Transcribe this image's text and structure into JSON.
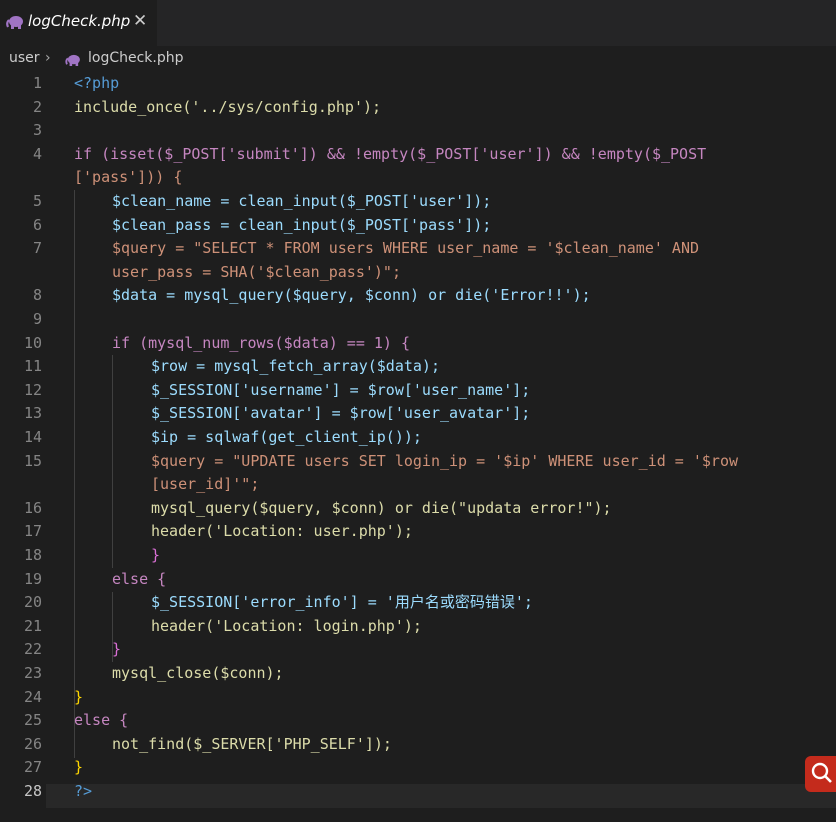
{
  "tab": {
    "title": "logCheck.php",
    "close_glyph": "✕",
    "icon": "php-elephant-icon"
  },
  "breadcrumb": {
    "folder": "user",
    "separator": "›",
    "file": "logCheck.php"
  },
  "colors": {
    "keyword": "#c586c0",
    "function": "#dcdcaa",
    "string": "#ce9178",
    "variable": "#9cdcfe",
    "number": "#b5cea8",
    "php_tag": "#569cd6"
  },
  "line_numbers": [
    "1",
    "2",
    "3",
    "4",
    "",
    "5",
    "6",
    "7",
    "",
    "8",
    "9",
    "10",
    "11",
    "12",
    "13",
    "14",
    "15",
    "",
    "16",
    "17",
    "18",
    "19",
    "20",
    "21",
    "22",
    "23",
    "24",
    "25",
    "26",
    "27",
    "28"
  ],
  "code": [
    "<?php",
    "include_once('../sys/config.php');",
    "",
    "if (isset($_POST['submit']) && !empty($_POST['user']) && !empty($_POST",
    "['pass'])) {",
    "$clean_name = clean_input($_POST['user']);",
    "$clean_pass = clean_input($_POST['pass']);",
    "$query = \"SELECT * FROM users WHERE user_name = '$clean_name' AND",
    "user_pass = SHA('$clean_pass')\";",
    "$data = mysql_query($query, $conn) or die('Error!!');",
    "",
    "if (mysql_num_rows($data) == 1) {",
    "$row = mysql_fetch_array($data);",
    "$_SESSION['username'] = $row['user_name'];",
    "$_SESSION['avatar'] = $row['user_avatar'];",
    "$ip = sqlwaf(get_client_ip());",
    "$query = \"UPDATE users SET login_ip = '$ip' WHERE user_id = '$row",
    "[user_id]'\";",
    "mysql_query($query, $conn) or die(\"updata error!\");",
    "header('Location: user.php');",
    "}",
    "else {",
    "$_SESSION['error_info'] = '用户名或密码错误';",
    "header('Location: login.php');",
    "}",
    "mysql_close($conn);",
    "}",
    "else {",
    "not_find($_SERVER['PHP_SELF']);",
    "}",
    "?>"
  ]
}
